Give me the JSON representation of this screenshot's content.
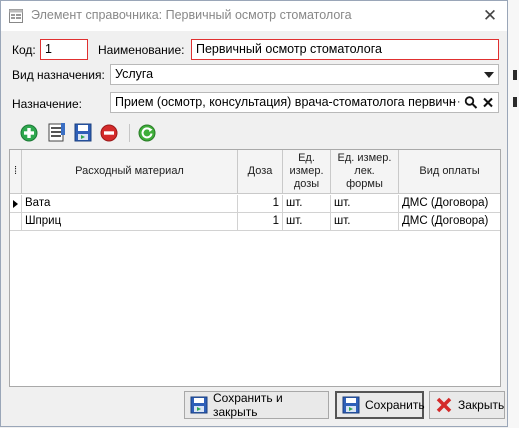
{
  "window": {
    "title": "Элемент справочника: Первичный осмотр стоматолога"
  },
  "form": {
    "code_label": "Код:",
    "code_value": "1",
    "name_label": "Наименование:",
    "name_value": "Первичный осмотр стоматолога",
    "type_label": "Вид назначения:",
    "type_value": "Услуга",
    "purpose_label": "Назначение:",
    "purpose_value": "Прием (осмотр, консультация) врача-стоматолога первичн",
    "purpose_more": "···"
  },
  "toolbar": {
    "buttons": [
      "add-icon",
      "edit-icon",
      "save-icon",
      "delete-icon",
      "refresh-icon"
    ]
  },
  "table": {
    "columns": {
      "marker": "⁞",
      "material": "Расходный материал",
      "dose": "Доза",
      "unit_dose": "Ед. измер. дозы",
      "unit_form": "Ед. измер. лек. формы",
      "payment": "Вид оплаты"
    },
    "rows": [
      {
        "material": "Вата",
        "dose": "1",
        "unit_dose": "шт.",
        "unit_form": "шт.",
        "payment": "ДМС (Договора)"
      },
      {
        "material": "Шприц",
        "dose": "1",
        "unit_dose": "шт.",
        "unit_form": "шт.",
        "payment": "ДМС (Договора)"
      }
    ]
  },
  "buttons": {
    "save_close": "Сохранить и закрыть",
    "save": "Сохранить",
    "close": "Закрыть"
  },
  "colors": {
    "required_border": "#e03030",
    "add": "#2fa84f",
    "delete": "#d42b2b",
    "refresh": "#3fae3a"
  }
}
